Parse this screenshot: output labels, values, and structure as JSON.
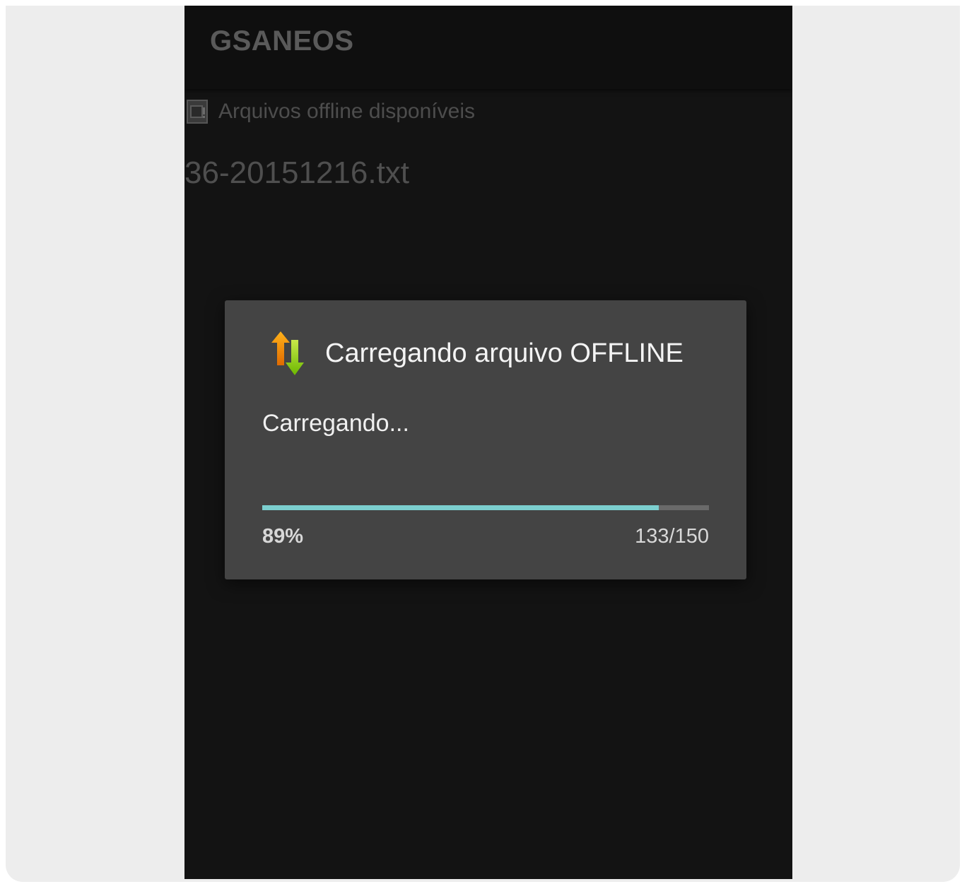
{
  "app": {
    "title": "GSANEOS"
  },
  "offline_section": {
    "icon": "sd-card-icon",
    "label": "Arquivos offline disponíveis"
  },
  "files": [
    {
      "name": "36-20151216.txt"
    }
  ],
  "dialog": {
    "icon": "up-down-arrows-icon",
    "title": "Carregando arquivo OFFLINE",
    "message": "Carregando...",
    "progress": {
      "fraction": 0.887,
      "percent_label": "89%",
      "count_label": "133/150"
    }
  },
  "colors": {
    "progress_fill": "#7ccfcf",
    "dialog_background": "#444444",
    "screen_background": "#131313"
  }
}
